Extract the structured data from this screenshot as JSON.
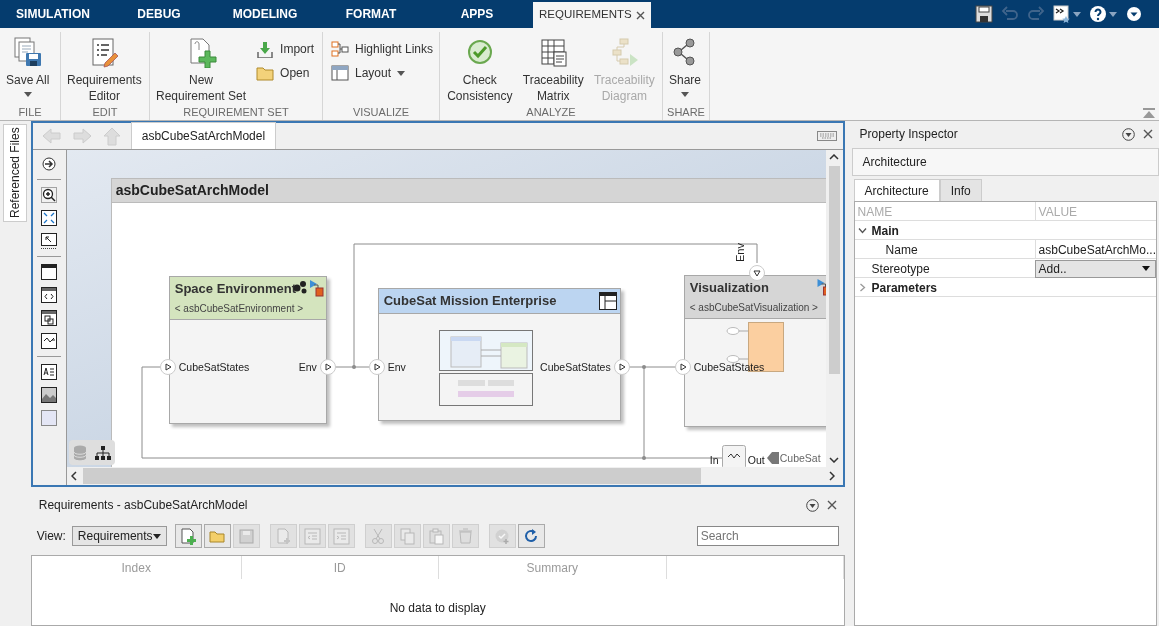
{
  "top_tabs": [
    {
      "label": "SIMULATION",
      "selected": false,
      "closable": false
    },
    {
      "label": "DEBUG",
      "selected": false,
      "closable": false
    },
    {
      "label": "MODELING",
      "selected": false,
      "closable": false
    },
    {
      "label": "FORMAT",
      "selected": false,
      "closable": false
    },
    {
      "label": "APPS",
      "selected": false,
      "closable": false
    },
    {
      "label": "REQUIREMENTS",
      "selected": true,
      "closable": true
    }
  ],
  "quick_access": [
    {
      "kind": "save",
      "disabled": false,
      "dropdown": false
    },
    {
      "kind": "undo",
      "disabled": true,
      "dropdown": false
    },
    {
      "kind": "redo",
      "disabled": true,
      "dropdown": false
    },
    {
      "kind": "command",
      "disabled": false,
      "dropdown": true
    },
    {
      "kind": "help",
      "disabled": false,
      "dropdown": true
    },
    {
      "kind": "collapse",
      "disabled": false,
      "dropdown": false
    }
  ],
  "ribbon": [
    {
      "label": "FILE",
      "items": [
        {
          "kind": "large",
          "label": "Save All",
          "dropdown": true,
          "disabled": false
        }
      ]
    },
    {
      "label": "EDIT",
      "items": [
        {
          "kind": "large",
          "label": "Requirements\nEditor",
          "dropdown": false,
          "disabled": false
        }
      ]
    },
    {
      "label": "REQUIREMENT SET",
      "items": [
        {
          "kind": "large",
          "label": "New\nRequirement Set",
          "dropdown": false,
          "disabled": false
        },
        {
          "kind": "small",
          "label": "Import",
          "dropdown": false,
          "disabled": false
        },
        {
          "kind": "small",
          "label": "Open",
          "dropdown": false,
          "disabled": false
        }
      ]
    },
    {
      "label": "VISUALIZE",
      "items": [
        {
          "kind": "small",
          "label": "Highlight Links",
          "dropdown": false,
          "disabled": false
        },
        {
          "kind": "small",
          "label": "Layout",
          "dropdown": true,
          "disabled": false
        }
      ]
    },
    {
      "label": "ANALYZE",
      "items": [
        {
          "kind": "large",
          "label": "Check\nConsistency",
          "dropdown": false,
          "disabled": false
        },
        {
          "kind": "large",
          "label": "Traceability\nMatrix",
          "dropdown": false,
          "disabled": false
        },
        {
          "kind": "large",
          "label": "Traceability\nDiagram",
          "dropdown": false,
          "disabled": true
        }
      ]
    },
    {
      "label": "SHARE",
      "items": [
        {
          "kind": "large",
          "label": "Share",
          "dropdown": true,
          "disabled": false
        }
      ]
    }
  ],
  "side_tab": "Referenced Files",
  "editor": {
    "tab": "asbCubeSatArchModel",
    "diagram": {
      "title": "asbCubeSatArchModel",
      "components": [
        {
          "kind": "reference",
          "name": "Space Environment",
          "stereotype": "< asbCubeSatEnvironment >",
          "color": "#d4e4be",
          "left_ports": [
            "CubeSatStates"
          ],
          "right_ports": [
            "Env"
          ]
        },
        {
          "kind": "architecture",
          "name": "CubeSat Mission Enterprise",
          "color": "#bcd5f1",
          "left_ports": [
            "Env"
          ],
          "right_ports": [
            "CubeSatStates"
          ]
        },
        {
          "kind": "reference",
          "name": "Visualization",
          "stereotype": "< asbCubeSatVisualization >",
          "color": "#d6d6d6",
          "left_ports": [
            "CubeSatStates"
          ],
          "top_ports": [
            "Env"
          ]
        }
      ],
      "adapter": {
        "in": "In",
        "out": "Out"
      },
      "out_port": "CubeSat"
    }
  },
  "requirements": {
    "title": "Requirements - asbCubeSatArchModel",
    "view_label": "View:",
    "view_value": "Requirements",
    "tools": [
      {
        "kind": "new-set",
        "disabled": false
      },
      {
        "kind": "open",
        "disabled": false
      },
      {
        "kind": "save",
        "disabled": true
      },
      {
        "kind": "add",
        "disabled": true
      },
      {
        "kind": "outdent",
        "disabled": true
      },
      {
        "kind": "indent",
        "disabled": true
      },
      {
        "kind": "cut",
        "disabled": true
      },
      {
        "kind": "copy",
        "disabled": true
      },
      {
        "kind": "paste",
        "disabled": true
      },
      {
        "kind": "delete",
        "disabled": true
      },
      {
        "kind": "verify",
        "disabled": true
      },
      {
        "kind": "refresh",
        "disabled": false
      }
    ],
    "search": {
      "placeholder": "Search"
    },
    "columns": [
      "Index",
      "ID",
      "Summary"
    ],
    "empty_text": "No data to display"
  },
  "inspector": {
    "title": "Property Inspector",
    "header": "Architecture",
    "tabs": [
      {
        "label": "Architecture",
        "selected": true
      },
      {
        "label": "Info",
        "selected": false
      }
    ],
    "columns": [
      "NAME",
      "VALUE"
    ],
    "items": [
      {
        "kind": "group",
        "label": "Main",
        "expanded": true,
        "children": [
          {
            "kind": "field",
            "label": "Name",
            "value": "asbCubeSatArchMo..."
          }
        ]
      },
      {
        "kind": "dropdown",
        "label": "Stereotype",
        "value": "Add.."
      },
      {
        "kind": "group",
        "label": "Parameters",
        "expanded": false
      }
    ]
  }
}
